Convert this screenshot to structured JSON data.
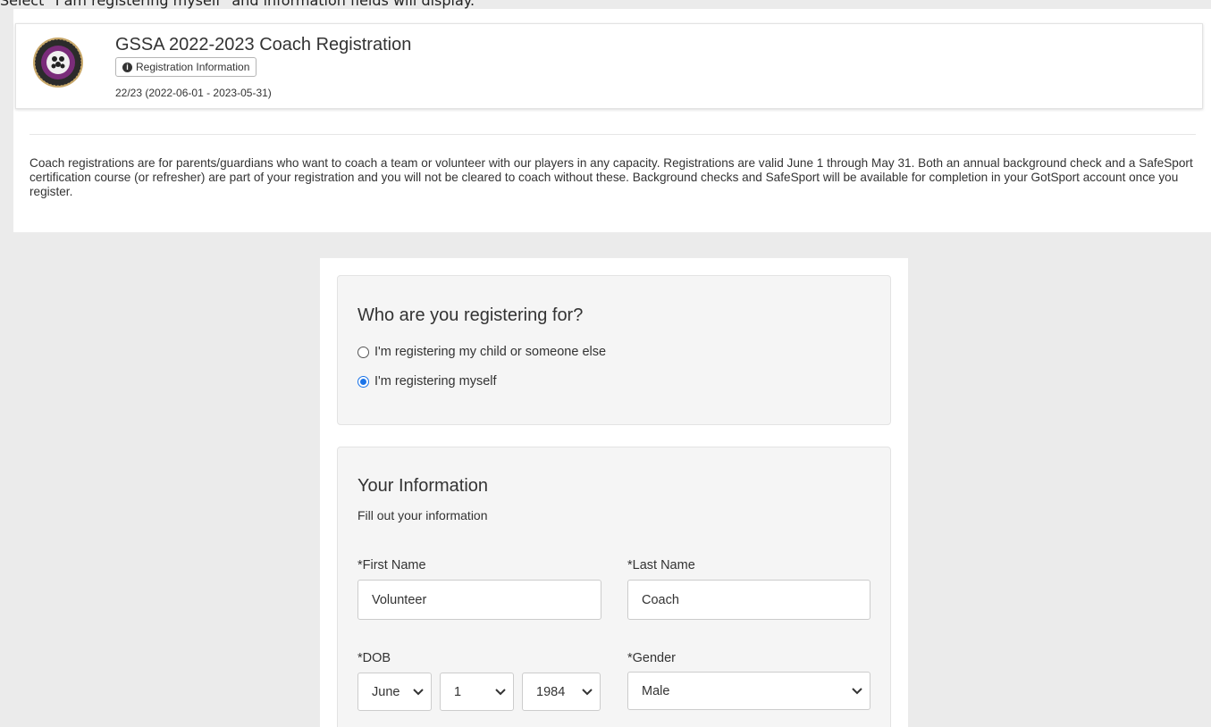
{
  "caption": "Select \"I am registering myself\" and information fields will display.",
  "header": {
    "title": "GSSA 2022-2023 Coach Registration",
    "info_button": "Registration Information",
    "season": "22/23 (2022-06-01 - 2023-05-31)",
    "logo_icon": "club-crest-icon"
  },
  "description": "Coach registrations are for parents/guardians who want to coach a team or volunteer with our players in any capacity. Registrations are valid June 1 through May 31. Both an annual background check and a SafeSport certification course (or refresher) are part of your registration and you will not be cleared to coach without these. Background checks and SafeSport will be available for completion in your GotSport account once you register.",
  "registering_for": {
    "title": "Who are you registering for?",
    "options": [
      {
        "label": "I'm registering my child or someone else",
        "checked": false
      },
      {
        "label": "I'm registering myself",
        "checked": true
      }
    ]
  },
  "your_info": {
    "title": "Your Information",
    "subtitle": "Fill out your information",
    "first_name": {
      "label": "*First Name",
      "value": "Volunteer"
    },
    "last_name": {
      "label": "*Last Name",
      "value": "Coach"
    },
    "dob": {
      "label": "*DOB",
      "month": "June",
      "day": "1",
      "year": "1984"
    },
    "gender": {
      "label": "*Gender",
      "value": "Male"
    }
  },
  "colors": {
    "accent": "#1a73e8",
    "page_bg": "#ebebeb",
    "well_bg": "#f5f5f5"
  }
}
